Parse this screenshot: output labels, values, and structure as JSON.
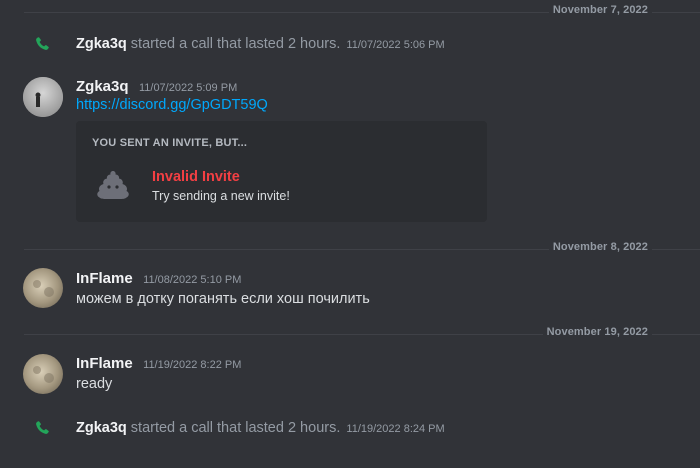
{
  "dates": [
    "November 7, 2022",
    "November 8, 2022",
    "November 19, 2022"
  ],
  "call1": {
    "user": "Zgka3q",
    "text": "started a call that lasted 2 hours.",
    "time": "11/07/2022 5:06 PM"
  },
  "msg1": {
    "user": "Zgka3q",
    "time": "11/07/2022 5:09 PM",
    "link": "https://discord.gg/GpGDT59Q"
  },
  "invite": {
    "header": "YOU SENT AN INVITE, BUT...",
    "title": "Invalid Invite",
    "subtitle": "Try sending a new invite!"
  },
  "msg2": {
    "user": "InFlame",
    "time": "11/08/2022 5:10 PM",
    "text": "можем в дотку поганять если хош почилить"
  },
  "msg3": {
    "user": "InFlame",
    "time": "11/19/2022 8:22 PM",
    "text": "ready"
  },
  "call2": {
    "user": "Zgka3q",
    "text": "started a call that lasted 2 hours.",
    "time": "11/19/2022 8:24 PM"
  },
  "colors": {
    "background": "#313338",
    "link": "#00a8fc",
    "error": "#f23f43",
    "call_icon": "#23a55a"
  },
  "icons": {
    "call": "phone-icon",
    "invalid_invite": "invalid-invite-icon"
  }
}
